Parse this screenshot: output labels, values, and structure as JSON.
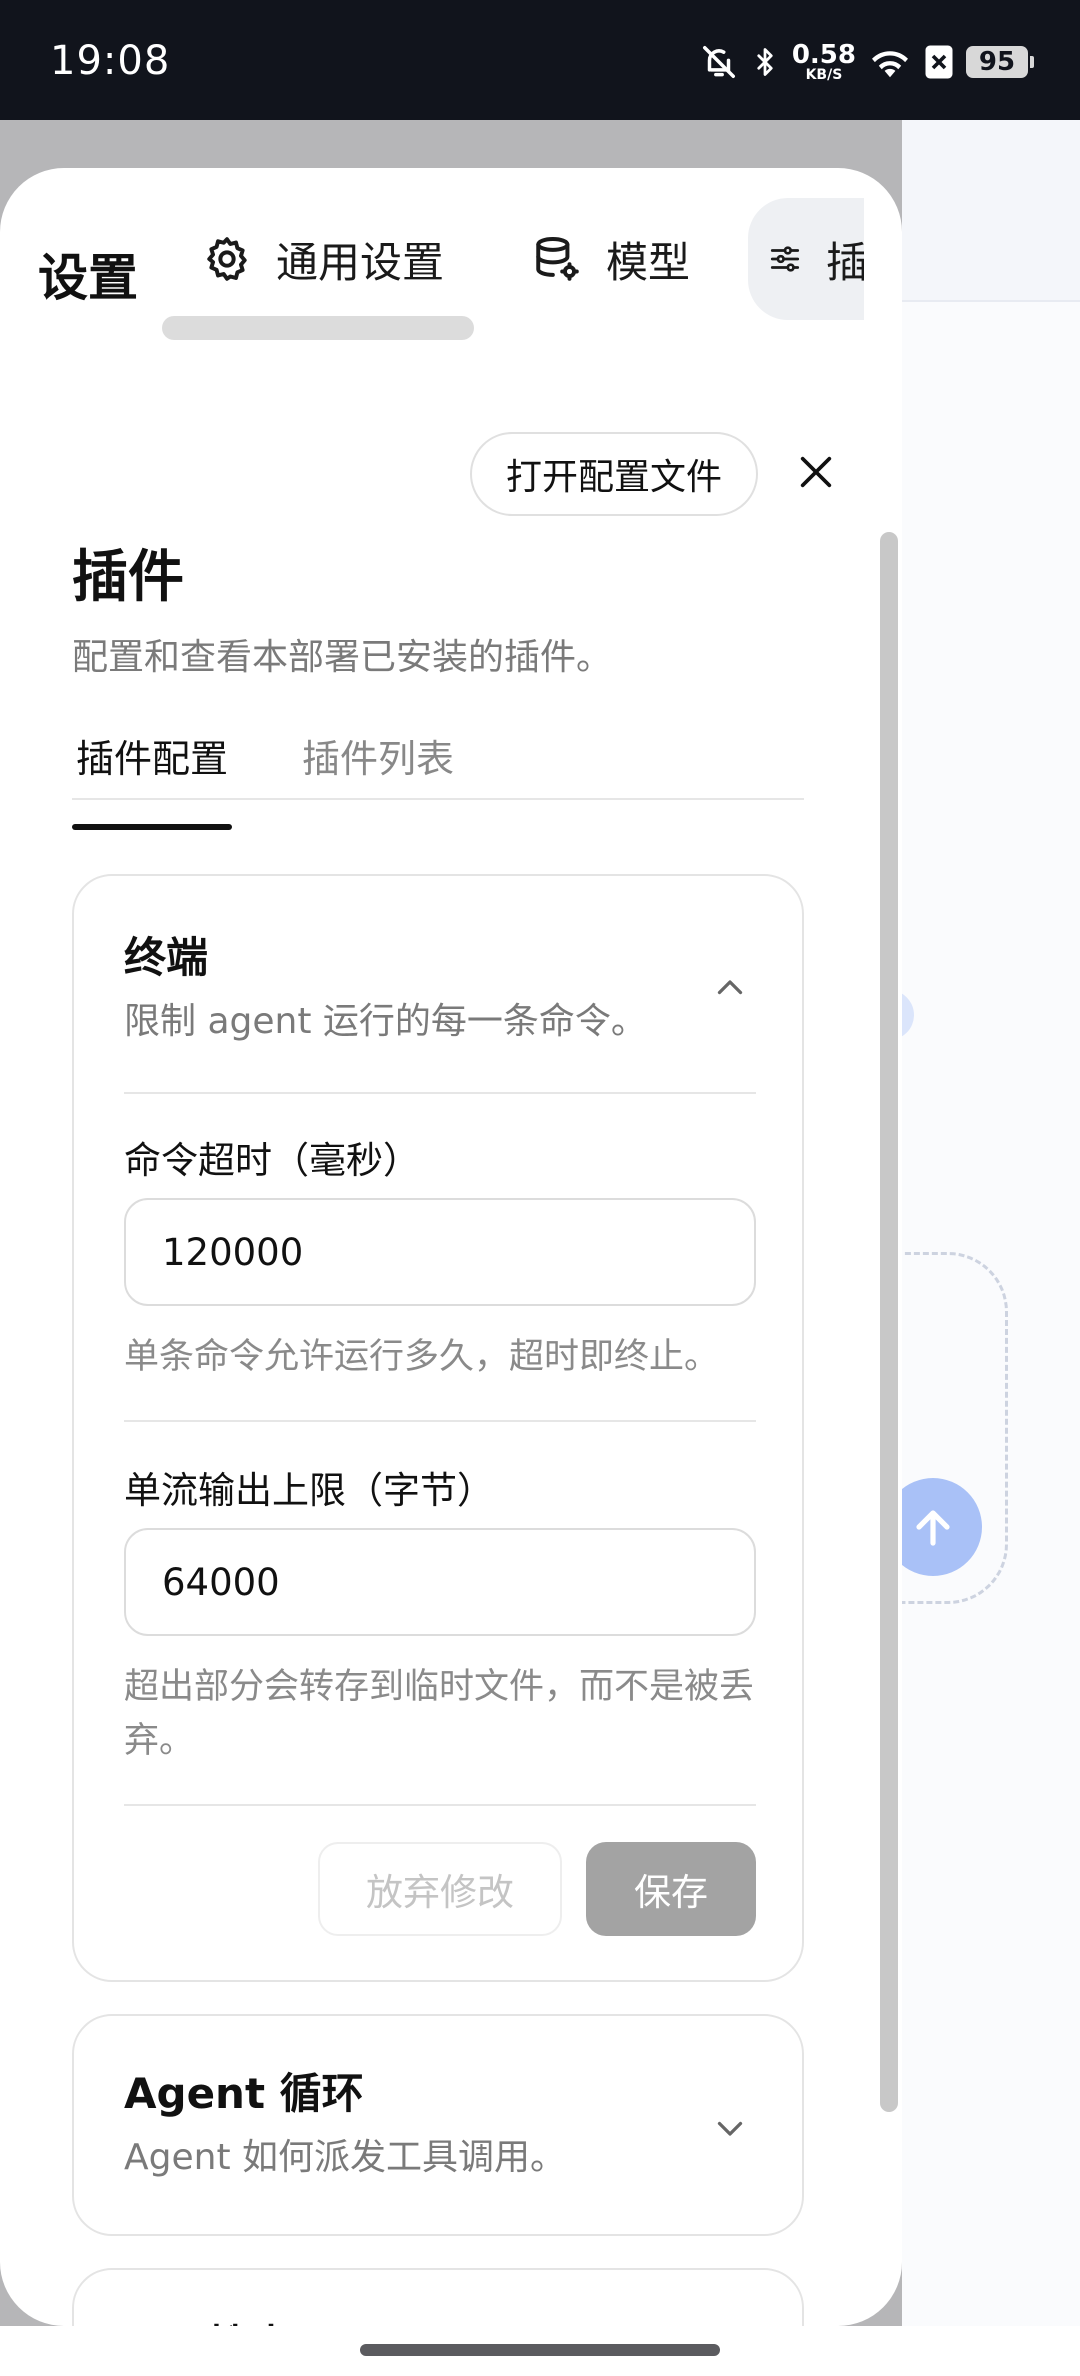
{
  "status_bar": {
    "time": "19:08",
    "net_speed_value": "0.58",
    "net_speed_unit": "KB/S",
    "battery": "95"
  },
  "settings": {
    "title": "设置",
    "tabs": [
      {
        "label": "通用设置",
        "icon": "gear-icon"
      },
      {
        "label": "模型",
        "icon": "database-gear-icon"
      },
      {
        "label": "插",
        "icon": "sliders-icon"
      }
    ]
  },
  "header_actions": {
    "open_config_label": "打开配置文件"
  },
  "section": {
    "title": "插件",
    "description": "配置和查看本部署已安装的插件。",
    "sub_tabs": [
      "插件配置",
      "插件列表"
    ],
    "active_sub_tab": "插件配置"
  },
  "terminal_card": {
    "title": "终端",
    "description": "限制 agent 运行的每一条命令。",
    "fields": [
      {
        "label": "命令超时（毫秒）",
        "value": "120000",
        "help": "单条命令允许运行多久，超时即终止。"
      },
      {
        "label": "单流输出上限（字节）",
        "value": "64000",
        "help": "超出部分会转存到临时文件，而不是被丢弃。"
      }
    ],
    "discard_label": "放弃修改",
    "save_label": "保存"
  },
  "agent_loop_card": {
    "title": "Agent 循环",
    "description": "Agent 如何派发工具调用。"
  },
  "third_card": {
    "title": "网页搜索"
  }
}
